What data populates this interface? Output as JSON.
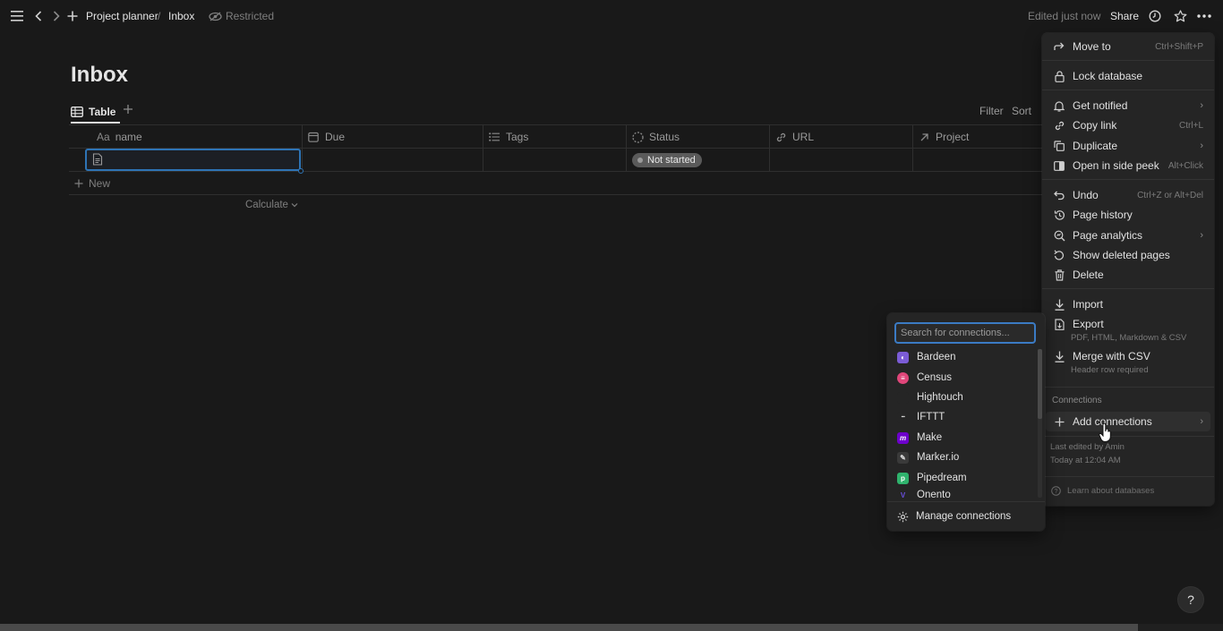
{
  "topbar": {
    "breadcrumb_workspace": "Project planner",
    "breadcrumb_sep": "/",
    "breadcrumb_page": "Inbox",
    "restricted": "Restricted",
    "edited": "Edited just now",
    "share": "Share"
  },
  "page": {
    "title": "Inbox",
    "view_tab": "Table",
    "filter": "Filter",
    "sort": "Sort",
    "columns": [
      {
        "label": "name",
        "icon": "text-property-icon",
        "prefix": "Aa"
      },
      {
        "label": "Due",
        "icon": "calendar-icon"
      },
      {
        "label": "Tags",
        "icon": "list-icon"
      },
      {
        "label": "Status",
        "icon": "status-icon"
      },
      {
        "label": "URL",
        "icon": "link-icon"
      },
      {
        "label": "Project",
        "icon": "relation-arrow-icon"
      }
    ],
    "row_status": "Not started",
    "new_label": "New",
    "calculate_label": "Calculate"
  },
  "menu": {
    "move_to": {
      "label": "Move to",
      "shortcut": "Ctrl+Shift+P"
    },
    "lock": {
      "label": "Lock database"
    },
    "get_notified": {
      "label": "Get notified"
    },
    "copy_link": {
      "label": "Copy link",
      "shortcut": "Ctrl+L"
    },
    "duplicate": {
      "label": "Duplicate"
    },
    "side_peek": {
      "label": "Open in side peek",
      "shortcut": "Alt+Click"
    },
    "undo": {
      "label": "Undo",
      "shortcut": "Ctrl+Z or Alt+Del"
    },
    "page_history": {
      "label": "Page history"
    },
    "page_analytics": {
      "label": "Page analytics"
    },
    "show_deleted": {
      "label": "Show deleted pages"
    },
    "delete": {
      "label": "Delete"
    },
    "import": {
      "label": "Import"
    },
    "export": {
      "label": "Export",
      "sub": "PDF, HTML, Markdown & CSV"
    },
    "merge_csv": {
      "label": "Merge with CSV",
      "sub": "Header row required"
    },
    "connections_heading": "Connections",
    "add_connections": {
      "label": "Add connections"
    },
    "last_edited_by": "Last edited by Amin",
    "last_edited_time": "Today at 12:04 AM",
    "learn": "Learn about databases"
  },
  "connections": {
    "search_placeholder": "Search for connections...",
    "items": [
      {
        "name": "Bardeen",
        "icon": "bardeen-logo-icon",
        "color": "#7b5cd6"
      },
      {
        "name": "Census",
        "icon": "census-logo-icon",
        "color": "#e0467a"
      },
      {
        "name": "Hightouch",
        "icon": "hightouch-logo-icon",
        "color": "#252525"
      },
      {
        "name": "IFTTT",
        "icon": "ifttt-logo-icon",
        "color": "#252525"
      },
      {
        "name": "Make",
        "icon": "make-logo-icon",
        "color": "#6d00cc"
      },
      {
        "name": "Marker.io",
        "icon": "markerio-logo-icon",
        "color": "#3a3a3a"
      },
      {
        "name": "Pipedream",
        "icon": "pipedream-logo-icon",
        "color": "#2fb36d"
      },
      {
        "name": "Onento",
        "icon": "onento-logo-icon",
        "color": "#5b3fd1"
      }
    ],
    "manage": "Manage connections"
  },
  "help": "?"
}
